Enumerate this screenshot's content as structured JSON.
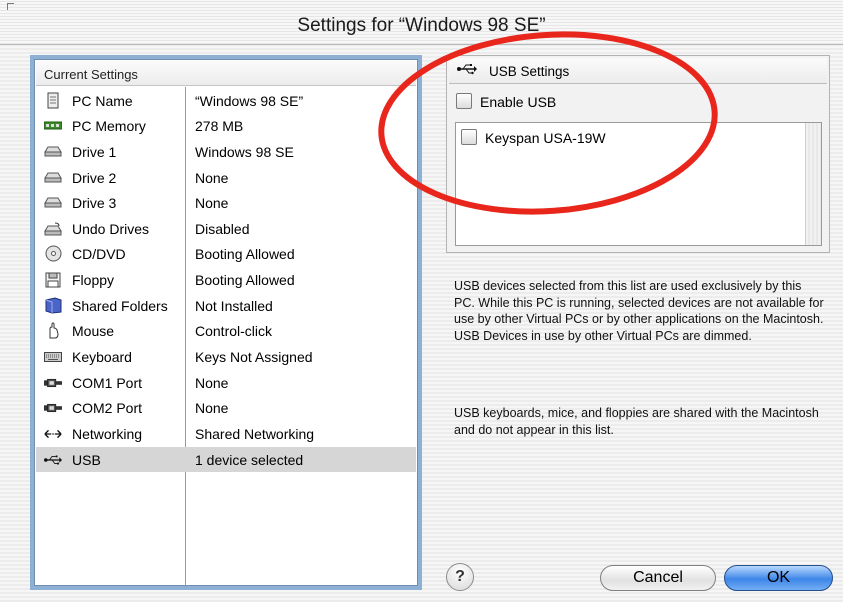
{
  "window": {
    "title": "Settings for “Windows 98 SE”"
  },
  "left_panel": {
    "header": "Current Settings",
    "rows": [
      {
        "name": "PC Name",
        "value": "“Windows 98 SE”",
        "icon": "document-icon"
      },
      {
        "name": "PC Memory",
        "value": "278 MB",
        "icon": "memory-chip-icon"
      },
      {
        "name": "Drive 1",
        "value": "Windows 98 SE",
        "icon": "hard-drive-icon"
      },
      {
        "name": "Drive 2",
        "value": "None",
        "icon": "hard-drive-icon"
      },
      {
        "name": "Drive 3",
        "value": "None",
        "icon": "hard-drive-icon"
      },
      {
        "name": "Undo Drives",
        "value": "Disabled",
        "icon": "undo-drive-icon"
      },
      {
        "name": "CD/DVD",
        "value": "Booting Allowed",
        "icon": "cd-icon"
      },
      {
        "name": "Floppy",
        "value": "Booting Allowed",
        "icon": "floppy-icon"
      },
      {
        "name": "Shared Folders",
        "value": "Not Installed",
        "icon": "folder-icon"
      },
      {
        "name": "Mouse",
        "value": "Control-click",
        "icon": "mouse-icon"
      },
      {
        "name": "Keyboard",
        "value": "Keys Not Assigned",
        "icon": "keyboard-icon"
      },
      {
        "name": "COM1 Port",
        "value": "None",
        "icon": "serial-port-icon"
      },
      {
        "name": "COM2 Port",
        "value": "None",
        "icon": "serial-port-icon"
      },
      {
        "name": "Networking",
        "value": "Shared Networking",
        "icon": "network-icon"
      },
      {
        "name": "USB",
        "value": "1 device selected",
        "icon": "usb-icon"
      }
    ],
    "selected_row": "USB"
  },
  "usb_panel": {
    "header": "USB Settings",
    "enable_label": "Enable USB",
    "enable_checked": false,
    "devices": [
      {
        "label": "Keyspan USA-19W",
        "checked": false
      }
    ]
  },
  "description": {
    "p1": "USB devices selected from this list are used exclusively by this PC. While this PC is running, selected devices are not available for use by other Virtual PCs or by other applications on the Macintosh. USB Devices in use by other Virtual PCs are dimmed.",
    "p2": "USB keyboards, mice, and floppies are shared with the Macintosh and do not appear in this list."
  },
  "buttons": {
    "help": "?",
    "cancel": "Cancel",
    "ok": "OK"
  },
  "colors": {
    "annotation": "#e8261c",
    "selection": "#d6d6d6",
    "default_button": "#3d86e8"
  }
}
